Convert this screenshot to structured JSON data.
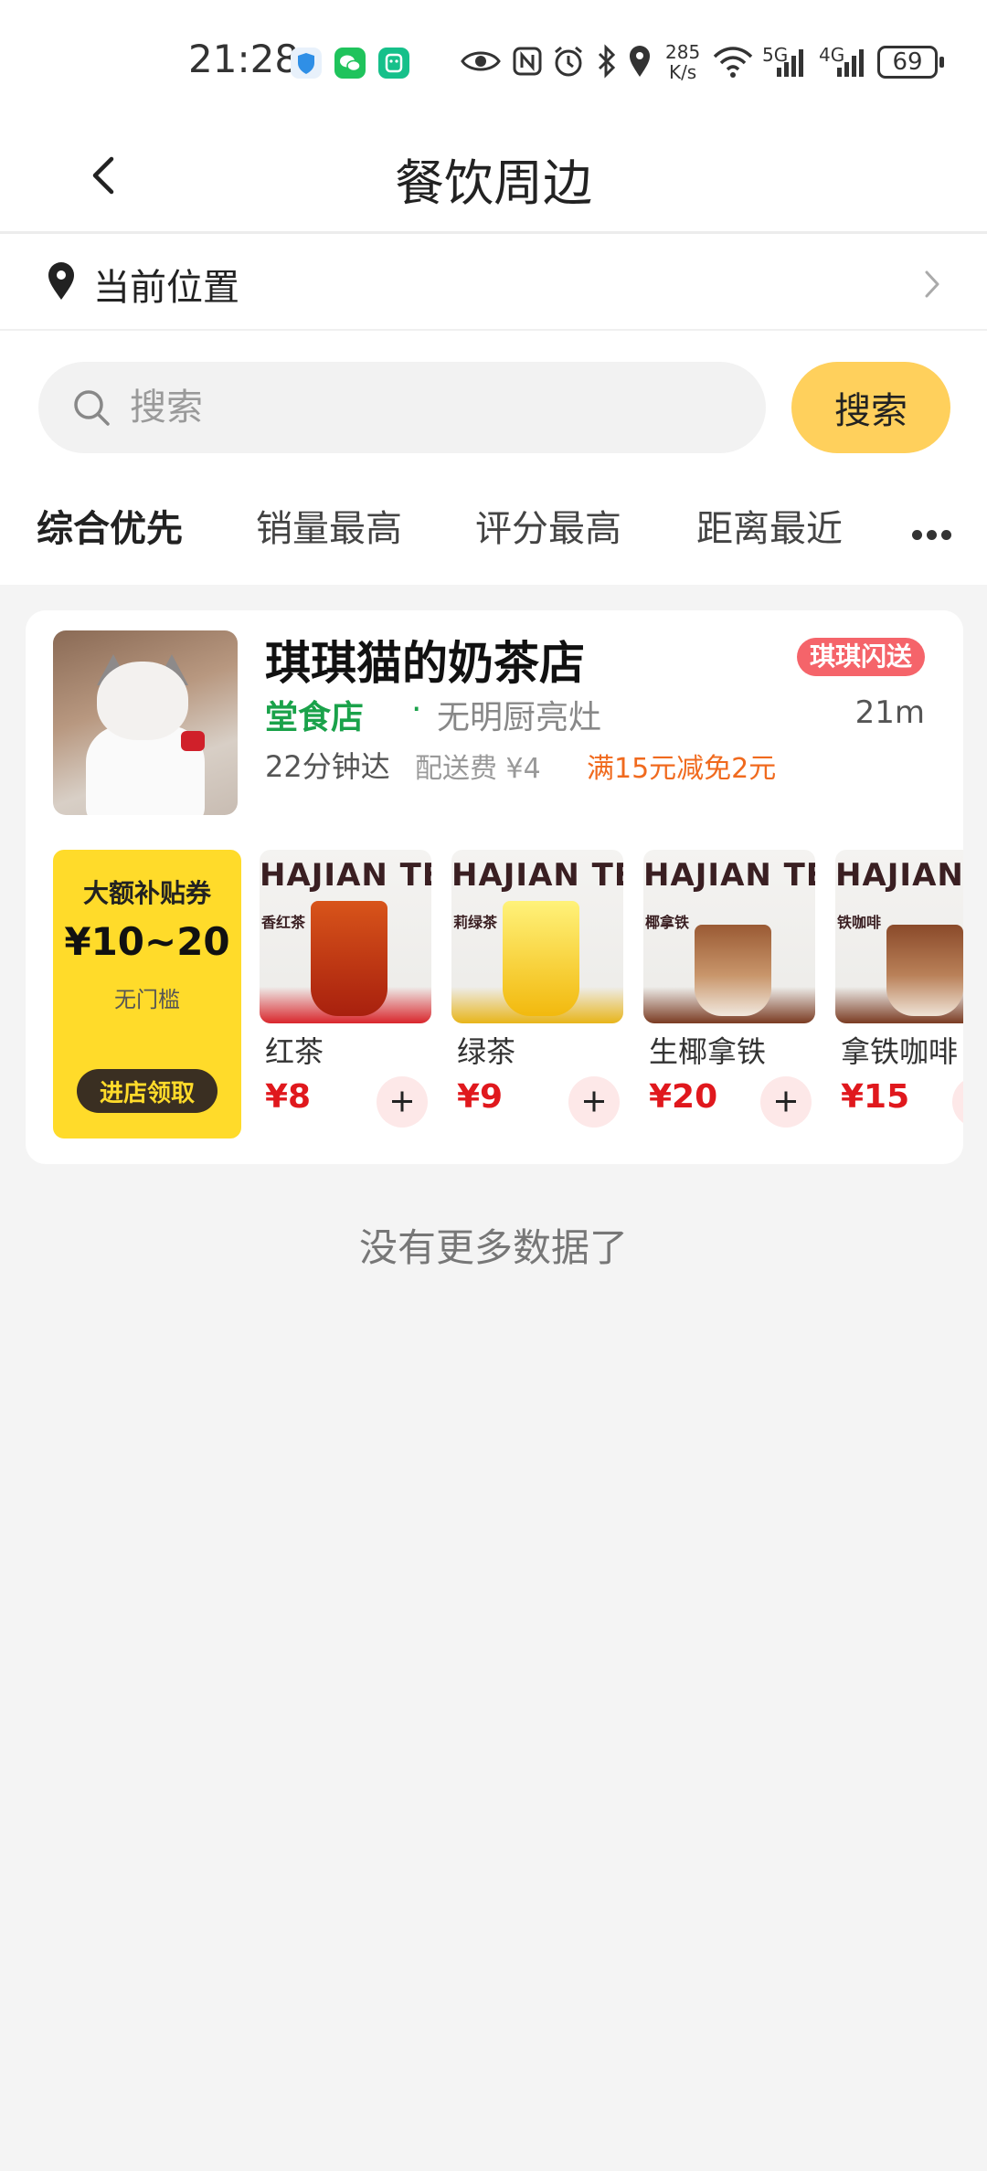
{
  "status_bar": {
    "time": "21:28",
    "net_speed_value": "285",
    "net_speed_unit": "K/s",
    "signal_1": "5G",
    "signal_2": "4G",
    "battery": "69",
    "icons": [
      "shield-app-icon",
      "wechat-icon",
      "mi-app-icon",
      "eye-icon",
      "nfc-icon",
      "alarm-icon",
      "bluetooth-icon",
      "location-icon",
      "wifi-icon",
      "signal-icon",
      "battery-icon"
    ]
  },
  "header": {
    "title": "餐饮周边"
  },
  "location": {
    "label": "当前位置"
  },
  "search": {
    "placeholder": "搜索",
    "button_label": "搜索"
  },
  "sort_tabs": [
    {
      "label": "综合优先",
      "active": true
    },
    {
      "label": "销量最高",
      "active": false
    },
    {
      "label": "评分最高",
      "active": false
    },
    {
      "label": "距离最近",
      "active": false
    }
  ],
  "shop": {
    "name": "琪琪猫的奶茶店",
    "delivery_badge": "琪琪闪送",
    "dine_in_tag": "堂食店",
    "separator": "·",
    "subtitle": "无明厨亮灶",
    "distance": "21m",
    "eta": "22分钟达",
    "delivery_fee": "配送费 ¥4",
    "promo": "满15元减免2元",
    "coupon": {
      "title": "大额补贴券",
      "amount": "¥10~20",
      "note": "无门槛",
      "button_label": "进店领取"
    },
    "products": [
      {
        "name": "红茶",
        "price": "¥8",
        "brand": "HAJIAN TEA",
        "label": "香红茶"
      },
      {
        "name": "绿茶",
        "price": "¥9",
        "brand": "HAJIAN TEA",
        "label": "莉绿茶"
      },
      {
        "name": "生椰拿铁",
        "price": "¥20",
        "brand": "HAJIAN TEA",
        "label": "椰拿铁"
      },
      {
        "name": "拿铁咖啡",
        "price": "¥15",
        "brand": "HAJIAN T",
        "label": "铁咖啡"
      }
    ]
  },
  "footer": {
    "no_more": "没有更多数据了"
  },
  "colors": {
    "accent": "#ffd05c",
    "price": "#e0181d",
    "dine_in": "#1aa24a",
    "promo": "#f06a1e",
    "badge": "#f5646a",
    "coupon": "#ffdb2a"
  }
}
